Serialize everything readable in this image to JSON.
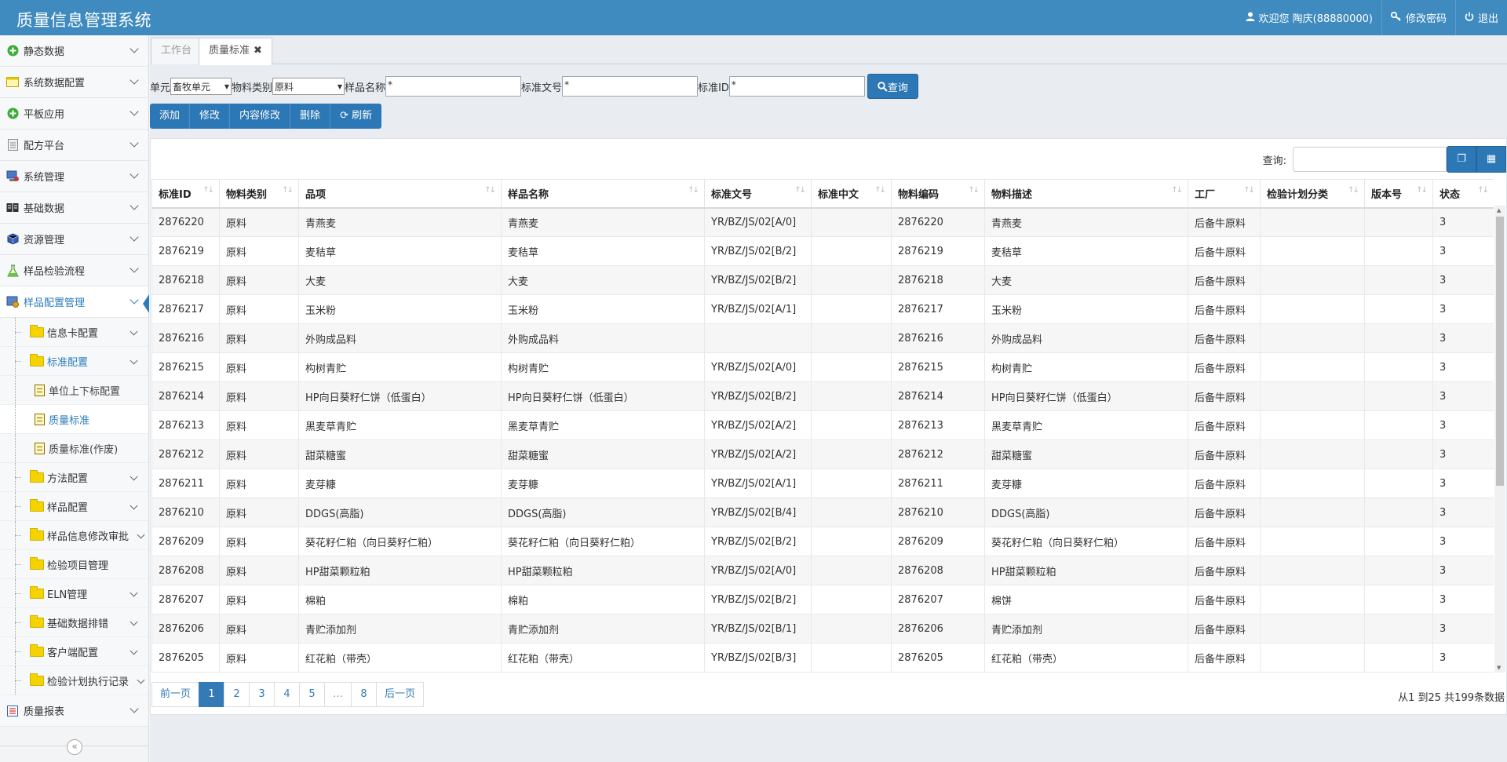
{
  "app": {
    "title": "质量信息管理系统"
  },
  "topbar": {
    "welcome": "欢迎您 陶庆(88880000)",
    "change_password": "修改密码",
    "logout": "退出"
  },
  "sidebar": {
    "items": [
      {
        "label": "静态数据",
        "icon": "plus-circle-icon"
      },
      {
        "label": "系统数据配置",
        "icon": "window-icon"
      },
      {
        "label": "平板应用",
        "icon": "plus-circle-icon"
      },
      {
        "label": "配方平台",
        "icon": "document-icon"
      },
      {
        "label": "系统管理",
        "icon": "computer-icon"
      },
      {
        "label": "基础数据",
        "icon": "book-icon"
      },
      {
        "label": "资源管理",
        "icon": "box-icon"
      },
      {
        "label": "样品检验流程",
        "icon": "flask-icon"
      },
      {
        "label": "样品配置管理",
        "icon": "sample-config-icon"
      }
    ],
    "sub_items": {
      "info_card": "信息卡配置",
      "standard_config": "标准配置",
      "leaf_unit": "单位上下标配置",
      "leaf_quality": "质量标准",
      "leaf_obsolete": "质量标准(作废)",
      "method": "方法配置",
      "sample": "样品配置",
      "sample_audit": "样品信息修改审批",
      "test_item": "检验项目管理",
      "eln": "ELN管理",
      "basic_sched": "基础数据排错",
      "client": "客户端配置",
      "plan_log": "检验计划执行记录"
    },
    "last_item": {
      "label": "质量报表",
      "icon": "report-icon"
    },
    "collapse": "«"
  },
  "tabs": [
    {
      "label": "工作台"
    },
    {
      "label": "质量标准",
      "close": "✖"
    }
  ],
  "search": {
    "unit_label": "单元",
    "unit_value": "畜牧单元",
    "material_type_label": "物料类别",
    "material_type_value": "原料",
    "sample_name_label": "样品名称",
    "sample_name_value": "*",
    "std_doc_label": "标准文号",
    "std_doc_value": "*",
    "std_id_label": "标准ID",
    "std_id_value": "*",
    "query_button": "查询"
  },
  "toolbar": {
    "add": "添加",
    "edit": "修改",
    "edit_content": "内容修改",
    "delete": "删除",
    "refresh": "刷新"
  },
  "filter": {
    "label": "查询:"
  },
  "table": {
    "columns": [
      "标准ID",
      "物料类别",
      "品项",
      "样品名称",
      "标准文号",
      "标准中文",
      "物料编码",
      "物料描述",
      "工厂",
      "检验计划分类",
      "版本号",
      "状态"
    ],
    "rows": [
      [
        "2876220",
        "原料",
        "青燕麦",
        "青燕麦",
        "YR/BZ/JS/02[A/0]",
        "",
        "2876220",
        "青燕麦",
        "后备牛原料",
        "",
        "",
        "3"
      ],
      [
        "2876219",
        "原料",
        "麦秸草",
        "麦秸草",
        "YR/BZ/JS/02[B/2]",
        "",
        "2876219",
        "麦秸草",
        "后备牛原料",
        "",
        "",
        "3"
      ],
      [
        "2876218",
        "原料",
        "大麦",
        "大麦",
        "YR/BZ/JS/02[B/2]",
        "",
        "2876218",
        "大麦",
        "后备牛原料",
        "",
        "",
        "3"
      ],
      [
        "2876217",
        "原料",
        "玉米粉",
        "玉米粉",
        "YR/BZ/JS/02[A/1]",
        "",
        "2876217",
        "玉米粉",
        "后备牛原料",
        "",
        "",
        "3"
      ],
      [
        "2876216",
        "原料",
        "外购成品料",
        "外购成品料",
        "",
        "",
        "2876216",
        "外购成品料",
        "后备牛原料",
        "",
        "",
        "3"
      ],
      [
        "2876215",
        "原料",
        "构树青贮",
        "构树青贮",
        "YR/BZ/JS/02[A/0]",
        "",
        "2876215",
        "构树青贮",
        "后备牛原料",
        "",
        "",
        "3"
      ],
      [
        "2876214",
        "原料",
        "HP向日葵籽仁饼（低蛋白）",
        "HP向日葵籽仁饼（低蛋白）",
        "YR/BZ/JS/02[B/2]",
        "",
        "2876214",
        "HP向日葵籽仁饼（低蛋白）",
        "后备牛原料",
        "",
        "",
        "3"
      ],
      [
        "2876213",
        "原料",
        "黑麦草青贮",
        "黑麦草青贮",
        "YR/BZ/JS/02[A/2]",
        "",
        "2876213",
        "黑麦草青贮",
        "后备牛原料",
        "",
        "",
        "3"
      ],
      [
        "2876212",
        "原料",
        "甜菜糖蜜",
        "甜菜糖蜜",
        "YR/BZ/JS/02[A/2]",
        "",
        "2876212",
        "甜菜糖蜜",
        "后备牛原料",
        "",
        "",
        "3"
      ],
      [
        "2876211",
        "原料",
        "麦芽糠",
        "麦芽糠",
        "YR/BZ/JS/02[A/1]",
        "",
        "2876211",
        "麦芽糠",
        "后备牛原料",
        "",
        "",
        "3"
      ],
      [
        "2876210",
        "原料",
        "DDGS(高脂)",
        "DDGS(高脂)",
        "YR/BZ/JS/02[B/4]",
        "",
        "2876210",
        "DDGS(高脂)",
        "后备牛原料",
        "",
        "",
        "3"
      ],
      [
        "2876209",
        "原料",
        "葵花籽仁粕（向日葵籽仁粕）",
        "葵花籽仁粕（向日葵籽仁粕）",
        "YR/BZ/JS/02[B/2]",
        "",
        "2876209",
        "葵花籽仁粕（向日葵籽仁粕）",
        "后备牛原料",
        "",
        "",
        "3"
      ],
      [
        "2876208",
        "原料",
        "HP甜菜颗粒粕",
        "HP甜菜颗粒粕",
        "YR/BZ/JS/02[A/0]",
        "",
        "2876208",
        "HP甜菜颗粒粕",
        "后备牛原料",
        "",
        "",
        "3"
      ],
      [
        "2876207",
        "原料",
        "棉粕",
        "棉粕",
        "YR/BZ/JS/02[B/2]",
        "",
        "2876207",
        "棉饼",
        "后备牛原料",
        "",
        "",
        "3"
      ],
      [
        "2876206",
        "原料",
        "青贮添加剂",
        "青贮添加剂",
        "YR/BZ/JS/02[B/1]",
        "",
        "2876206",
        "青贮添加剂",
        "后备牛原料",
        "",
        "",
        "3"
      ],
      [
        "2876205",
        "原料",
        "红花粕（带壳）",
        "红花粕（带壳）",
        "YR/BZ/JS/02[B/3]",
        "",
        "2876205",
        "红花粕（带壳）",
        "后备牛原料",
        "",
        "",
        "3"
      ]
    ]
  },
  "pager": {
    "prev": "前一页",
    "pages": [
      "1",
      "2",
      "3",
      "4",
      "5",
      "…",
      "8"
    ],
    "current": "1",
    "next": "后一页",
    "info": "从1 到25 共199条数据"
  }
}
